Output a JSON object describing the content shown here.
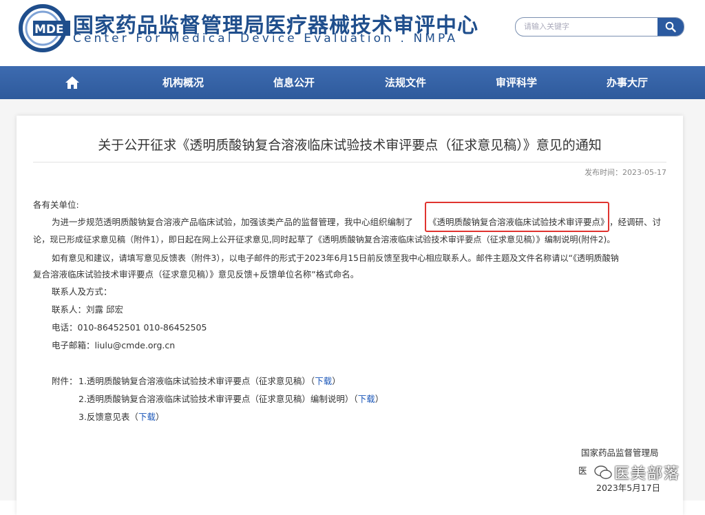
{
  "header": {
    "title_cn": "国家药品监督管理局医疗器械技术审评中心",
    "title_en": "Center For Medical Device Evaluation . NMPA",
    "logo_text": "MDE",
    "search_placeholder": "请输入关键字"
  },
  "nav": {
    "items": [
      {
        "label": "机构概况"
      },
      {
        "label": "信息公开"
      },
      {
        "label": "法规文件"
      },
      {
        "label": "审评科学"
      },
      {
        "label": "办事大厅"
      }
    ]
  },
  "article": {
    "title": "关于公开征求《透明质酸钠复合溶液临床试验技术审评要点（征求意见稿）》意见的通知",
    "publish_date": "发布时间：2023-05-17",
    "greeting": "各有关单位:",
    "p1_line1_a": "为进一步规范透明质酸钠复合溶液产品临床试验，加强该类产品的监督管理，我中心组织编制了",
    "p1_highlight": "《透明质酸钠复合溶液临床试验技术审评要点》",
    "p1_line1_b": "，经调研、讨",
    "p1_line2": "论，现已形成征求意见稿（附件1），即日起在网上公开征求意见,同时起草了《透明质酸钠复合溶液临床试验技术审评要点（征求意见稿）》编制说明(附件2)。",
    "p2_line1": "如有意见和建议，请填写意见反馈表（附件3），以电子邮件的形式于2023年6月15日前反馈至我中心相应联系人。邮件主题及文件名称请以“《透明质酸钠",
    "p2_line2": "复合溶液临床试验技术审评要点（征求意见稿）》意见反馈+反馈单位名称”格式命名。",
    "contact_heading": "联系人及方式：",
    "contact_person": "联系人：刘露  邱宏",
    "phone": "电话：010-86452501  010-86452505",
    "email": "电子邮箱：liulu@cmde.org.cn",
    "attachments_label": "附件：",
    "attachments": [
      {
        "text": "1.透明质酸钠复合溶液临床试验技术审评要点（征求意见稿）（",
        "link": "下载",
        "close": "）"
      },
      {
        "text": "2.透明质酸钠复合溶液临床试验技术审评要点（征求意见稿）编制说明）（",
        "link": "下载",
        "close": "）"
      },
      {
        "text": "3.反馈意见表（",
        "link": "下载",
        "close": "）"
      }
    ],
    "signature_org": "国家药品监督管理局",
    "signature_org2_partial": "医",
    "signature_date": "2023年5月17日"
  },
  "watermark": {
    "text": "医美部落"
  },
  "colors": {
    "brand": "#1f4e8c",
    "nav": "#2e5a9c",
    "highlight": "#e0332f",
    "link": "#1a56b8"
  }
}
